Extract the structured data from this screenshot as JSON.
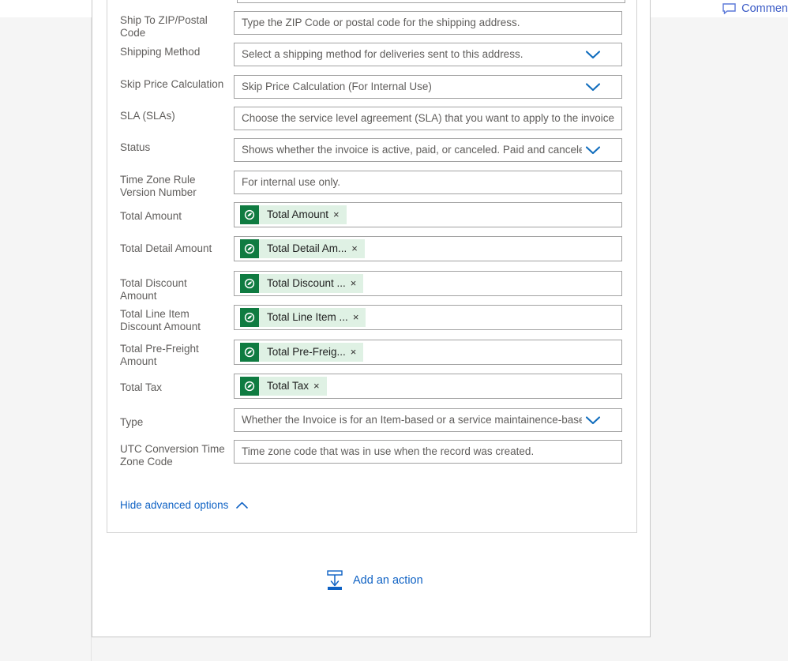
{
  "header": {
    "comment_label": "Comment",
    "comment_icon": "speech-bubble-icon"
  },
  "colors": {
    "page_background": "#f5f5f5",
    "card_background": "#ffffff",
    "label_text": "#605e5c",
    "link_blue": "#0f62c4",
    "chevron_blue": "#0f6cbd",
    "token_icon_green": "#0f7b41",
    "token_chip_green": "#dff1e4",
    "field_border": "#a2a2a2"
  },
  "form": {
    "rows": [
      {
        "label": "Ship To ZIP/Postal Code",
        "type": "text",
        "placeholder": "Type the ZIP Code or postal code for the shipping address.",
        "name": "ship-to-zip-postal-code"
      },
      {
        "label": "Shipping Method",
        "type": "dropdown",
        "placeholder": "Select a shipping method for deliveries sent to this address.",
        "name": "shipping-method"
      },
      {
        "label": "Skip Price Calculation",
        "type": "dropdown",
        "placeholder": "Skip Price Calculation (For Internal Use)",
        "name": "skip-price-calculation"
      },
      {
        "label": "SLA (SLAs)",
        "type": "text",
        "placeholder": "Choose the service level agreement (SLA) that you want to apply to the invoice",
        "name": "sla-slas"
      },
      {
        "label": "Status",
        "type": "dropdown",
        "placeholder": "Shows whether the invoice is active, paid, or canceled. Paid and canceled",
        "name": "status"
      },
      {
        "label": "Time Zone Rule Version Number",
        "type": "text",
        "placeholder": "For internal use only.",
        "name": "time-zone-rule-version-number"
      },
      {
        "label": "Total Amount",
        "type": "token",
        "token_label": "Total Amount",
        "token_icon": "dataverse-icon",
        "token_remove": "×",
        "name": "total-amount"
      },
      {
        "label": "Total Detail Amount",
        "type": "token",
        "token_label": "Total Detail Am...",
        "token_icon": "dataverse-icon",
        "token_remove": "×",
        "name": "total-detail-amount"
      },
      {
        "label": "Total Discount Amount",
        "type": "token",
        "token_label": "Total Discount ...",
        "token_icon": "dataverse-icon",
        "token_remove": "×",
        "name": "total-discount-amount"
      },
      {
        "label": "Total Line Item Discount Amount",
        "type": "token",
        "token_label": "Total Line Item ...",
        "token_icon": "dataverse-icon",
        "token_remove": "×",
        "name": "total-line-item-discount-amount"
      },
      {
        "label": "Total Pre-Freight Amount",
        "type": "token",
        "token_label": "Total Pre-Freig...",
        "token_icon": "dataverse-icon",
        "token_remove": "×",
        "name": "total-pre-freight-amount"
      },
      {
        "label": "Total Tax",
        "type": "token",
        "token_label": "Total Tax",
        "token_icon": "dataverse-icon",
        "token_remove": "×",
        "name": "total-tax"
      },
      {
        "label": "Type",
        "type": "dropdown",
        "placeholder": "Whether the Invoice is for an Item-based or a service maintainence-based",
        "name": "type"
      },
      {
        "label": "UTC Conversion Time Zone Code",
        "type": "text",
        "placeholder": "Time zone code that was in use when the record was created.",
        "name": "utc-conversion-time-zone-code"
      }
    ],
    "hide_advanced_label": "Hide advanced options",
    "hide_advanced_icon": "chevron-up-icon"
  },
  "footer": {
    "add_action_label": "Add an action",
    "add_action_icon": "insert-action-icon"
  }
}
